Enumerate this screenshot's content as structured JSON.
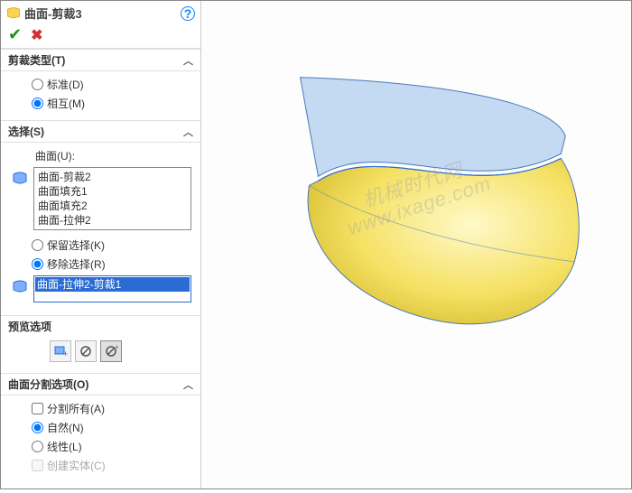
{
  "feature": {
    "title": "曲面-剪裁3"
  },
  "trimType": {
    "heading": "剪裁类型(T)",
    "optStandard": "标准(D)",
    "optMutual": "相互(M)"
  },
  "selection": {
    "heading": "选择(S)",
    "surfacesLabel": "曲面(U):",
    "surfaces": [
      "曲面-剪裁2",
      "曲面填充1",
      "曲面填充2",
      "曲面-拉伸2"
    ],
    "optKeep": "保留选择(K)",
    "optRemove": "移除选择(R)",
    "removeItems": [
      "曲面-拉伸2-剪裁1"
    ]
  },
  "preview": {
    "heading": "预览选项"
  },
  "splitOptions": {
    "heading": "曲面分割选项(O)",
    "chkSplitAll": "分割所有(A)",
    "optNatural": "自然(N)",
    "optLinear": "线性(L)",
    "chkCreateSolid": "创建实体(C)"
  },
  "watermark": "机械时代网\nwww.ixage.com"
}
